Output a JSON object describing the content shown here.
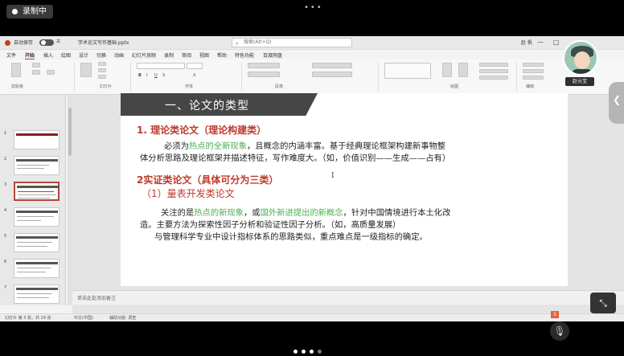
{
  "recording": {
    "label": "录制中"
  },
  "titlebar": {
    "autosave_label": "自动保存",
    "autosave_state": "关",
    "filename": "学术论文写作基础.pptx",
    "search_placeholder": "搜索(Alt+Q)",
    "user_name": "赵 帆"
  },
  "menu": [
    "文件",
    "开始",
    "插入",
    "绘图",
    "设计",
    "切换",
    "动画",
    "幻灯片放映",
    "录制",
    "审阅",
    "视图",
    "帮助",
    "特色功能",
    "百度网盘"
  ],
  "ribbon": {
    "groups": [
      "剪贴板",
      "幻灯片",
      "字体",
      "段落",
      "绘图",
      "编辑"
    ],
    "share_label": "共享"
  },
  "slides_panel": {
    "numbers": [
      "1",
      "2",
      "3",
      "4",
      "5",
      "6",
      "7",
      "8",
      "9"
    ],
    "selected": 3
  },
  "slide": {
    "title": "一、论文的类型",
    "h1": "1. 理论类论文（理论构建类）",
    "p1_a": "必须为",
    "p1_green": "热点的全新现象",
    "p1_b": "，且概念的内涵丰富。基于经典理论框架构建新事物整",
    "p1_line2": "体分析思路及理论框架并描述特征，写作难度大。（如，价值识别——生成——占有）",
    "h2": "2实证类论文（具体可分为三类）",
    "h2_sub": "（1）量表开发类论文",
    "p2_a": "关注的是",
    "p2_green1": "热点的新现象",
    "p2_b": "，或",
    "p2_green2": "国外新进提出的新概念",
    "p2_c": "，针对中国情境进行本土化改",
    "p2_line2": "造。主要方法为探索性因子分析和验证性因子分析。（如，高质量发展）",
    "p3": "与管理科学专业中设计指标体系的思路类似，重点难点是一级指标的确定。"
  },
  "notes": {
    "placeholder": "单击此处添加备注"
  },
  "status": {
    "slide_counter": "幻灯片 第 3 张，共 29 张",
    "language": "中文(中国)",
    "accessibility": "辅助功能: 调查"
  },
  "webcam": {
    "name": "赵元宝"
  }
}
